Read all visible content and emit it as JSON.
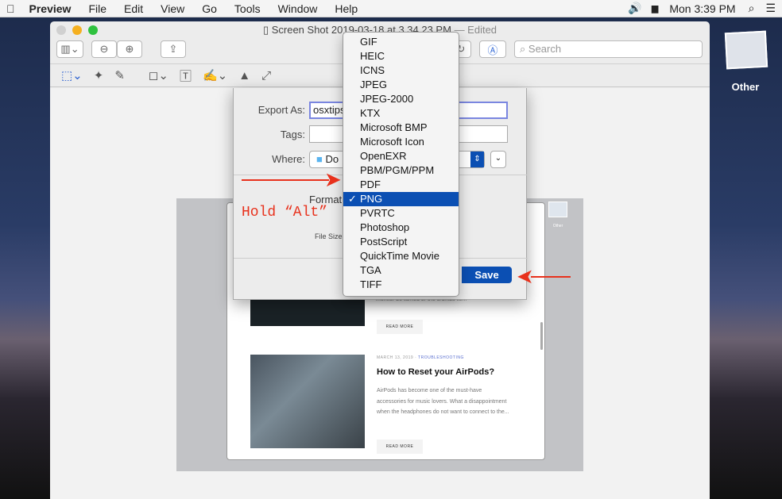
{
  "menubar": {
    "app": "Preview",
    "items": [
      "File",
      "Edit",
      "View",
      "Go",
      "Tools",
      "Window",
      "Help"
    ],
    "clock": "Mon 3:39 PM"
  },
  "window": {
    "title": "Screen Shot 2019-03-18 at 3.34.23 PM",
    "edited": "— Edited",
    "search_placeholder": "Search"
  },
  "dialog": {
    "export_as_label": "Export As:",
    "export_as_value": "osxtips",
    "tags_label": "Tags:",
    "where_label": "Where:",
    "where_value": "Do",
    "format_label": "Format",
    "file_size_label": "File Size",
    "save": "Save"
  },
  "format_menu": {
    "items": [
      "GIF",
      "HEIC",
      "ICNS",
      "JPEG",
      "JPEG-2000",
      "KTX",
      "Microsoft BMP",
      "Microsoft Icon",
      "OpenEXR",
      "PBM/PGM/PPM",
      "PDF",
      "PNG",
      "PVRTC",
      "Photoshop",
      "PostScript",
      "QuickTime Movie",
      "TGA",
      "TIFF"
    ],
    "selected": "PNG",
    "check": "✓"
  },
  "annotation": {
    "text": "Hold “Alt”",
    "color": "#e8311c"
  },
  "desktop": {
    "icon_label": "Other",
    "inner_icon_label": "Other"
  },
  "article": {
    "prev_excerpt": "monitor be turned or the crumbs lie...",
    "read_more": "READ MORE",
    "date": "MARCH 13, 2019",
    "category": "TROUBLESHOOTING",
    "title": "How to Reset your AirPods?",
    "excerpt": "AirPods has become one of the must-have accessories for music lovers. What a disappointment when the headphones do not want to connect to the..."
  },
  "colors": {
    "accent": "#0b4fb3",
    "arrow": "#e8311c",
    "category": "#5a6fd0"
  }
}
